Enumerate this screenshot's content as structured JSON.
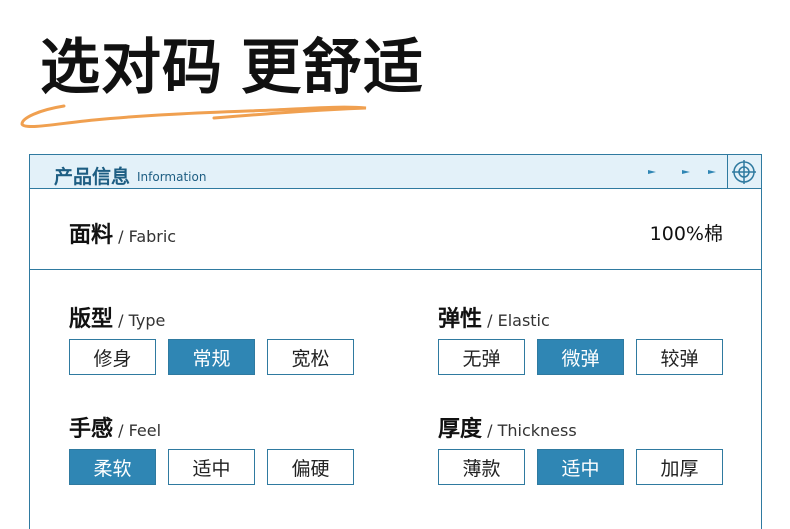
{
  "headline": {
    "part1": "选对码",
    "part2": "更舒适"
  },
  "card": {
    "title": "产品信息",
    "subtitle": "Information",
    "fabric": {
      "label_cn": "面料",
      "label_en": " / Fabric",
      "value": "100%棉"
    },
    "groups": [
      {
        "label_cn": "版型",
        "label_en": " / Type",
        "options": [
          "修身",
          "常规",
          "宽松"
        ],
        "selected": 1
      },
      {
        "label_cn": "弹性",
        "label_en": " / Elastic",
        "options": [
          "无弹",
          "微弹",
          "较弹"
        ],
        "selected": 1
      },
      {
        "label_cn": "手感",
        "label_en": " / Feel",
        "options": [
          "柔软",
          "适中",
          "偏硬"
        ],
        "selected": 0
      },
      {
        "label_cn": "厚度",
        "label_en": " / Thickness",
        "options": [
          "薄款",
          "适中",
          "加厚"
        ],
        "selected": 1
      }
    ]
  },
  "colors": {
    "accent": "#2f86b4",
    "border": "#2f7aa0",
    "header_bg": "#e3f1f9",
    "swoosh": "#f0a050"
  },
  "icons": [
    "arrow-right-icon",
    "crosshair-icon"
  ]
}
